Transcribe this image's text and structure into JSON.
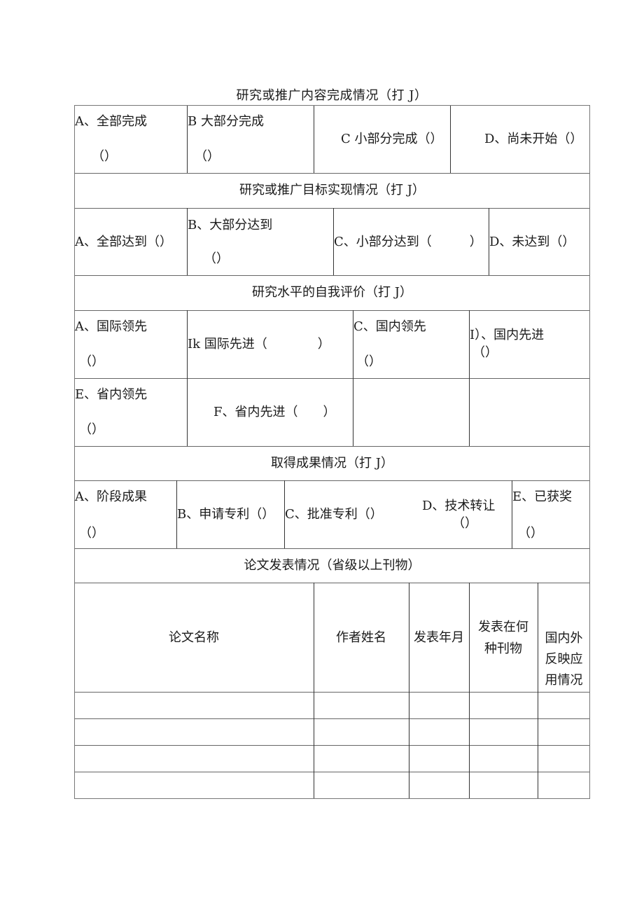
{
  "document": {
    "title": "研究或推广内容完成情况（打 J）"
  },
  "content_completion": {
    "options": [
      {
        "label": "A、全部完成",
        "mark": "（）"
      },
      {
        "label": "B 大部分完成",
        "mark": "（）"
      },
      {
        "label": "C 小部分完成（）"
      },
      {
        "label": "D、尚未开始（）"
      }
    ]
  },
  "goal_achievement": {
    "heading": "研究或推广目标实现情况（打 J）",
    "options": [
      {
        "label": "A、全部达到（）"
      },
      {
        "label": "B、大部分达到",
        "mark": "（）"
      },
      {
        "label": "C、小部分达到（　　　）"
      },
      {
        "label": "D、未达到（）"
      }
    ]
  },
  "self_evaluation": {
    "heading": "研究水平的自我评价（打 J）",
    "options": [
      {
        "label": "A、国际领先",
        "mark": "（）"
      },
      {
        "label": "Ik 国际先进（　　　　）"
      },
      {
        "label": "C、国内领先",
        "mark": "（）"
      },
      {
        "label": "I）、国内先进",
        "mark": "（）"
      },
      {
        "label": "E、省内领先",
        "mark": "（）"
      },
      {
        "label": "F、省内先进（　　）"
      }
    ]
  },
  "achievements": {
    "heading": "取得成果情况（打 J）",
    "options": [
      {
        "label": "A、阶段成果",
        "mark": "（）"
      },
      {
        "label": "B、申请专利（）"
      },
      {
        "label": "C、批准专利（）"
      },
      {
        "label": "D、技术转让",
        "mark": "（）"
      },
      {
        "label": "E、已获奖",
        "mark": "（）"
      }
    ]
  },
  "papers": {
    "heading": "论文发表情况（省级以上刊物）",
    "columns": [
      {
        "label": "论文名称"
      },
      {
        "label": "作者姓名"
      },
      {
        "label": "发表年月"
      },
      {
        "label_line1": "发表在何",
        "label_line2": "种刊物"
      },
      {
        "label_line1": "国内外",
        "label_line2": "反映应",
        "label_line3": "用情况"
      }
    ],
    "rows": [
      [
        "",
        "",
        "",
        "",
        ""
      ],
      [
        "",
        "",
        "",
        "",
        ""
      ],
      [
        "",
        "",
        "",
        "",
        ""
      ],
      [
        "",
        "",
        "",
        "",
        ""
      ]
    ]
  }
}
